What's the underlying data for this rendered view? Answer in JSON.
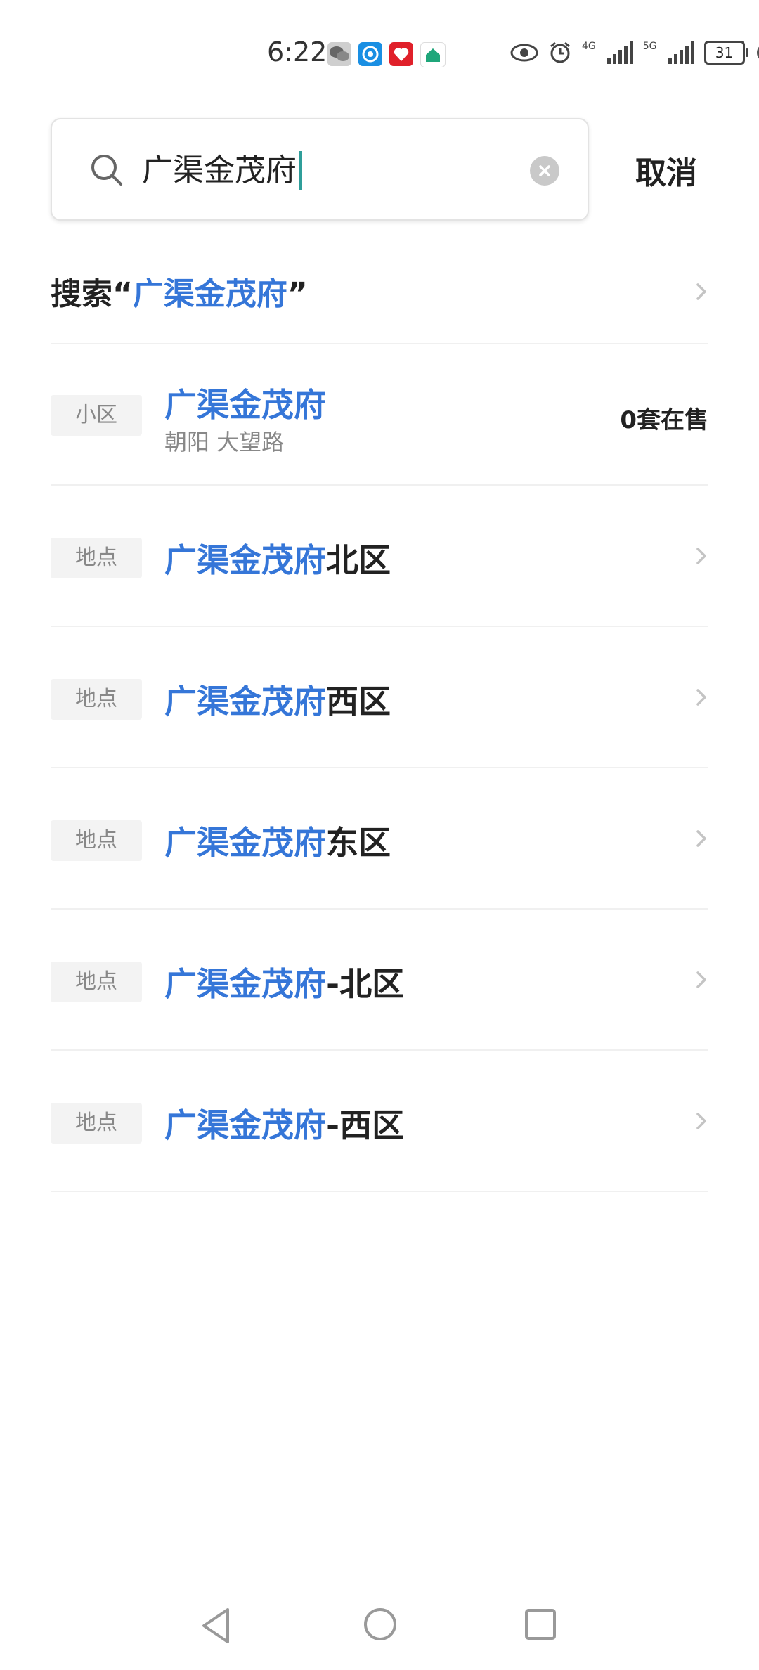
{
  "status_bar": {
    "time": "6:22",
    "net1": "4G",
    "net2": "5G",
    "battery": "31"
  },
  "search": {
    "query": "广渠金茂府",
    "cancel_label": "取消"
  },
  "search_for": {
    "prefix": "搜索“",
    "keyword": "广渠金茂府",
    "suffix": "”"
  },
  "results": [
    {
      "tag": "小区",
      "highlight": "广渠金茂府",
      "rest": "",
      "subtitle": "朝阳 大望路",
      "count": "0套在售"
    },
    {
      "tag": "地点",
      "highlight": "广渠金茂府",
      "rest": "北区"
    },
    {
      "tag": "地点",
      "highlight": "广渠金茂府",
      "rest": "西区"
    },
    {
      "tag": "地点",
      "highlight": "广渠金茂府",
      "rest": "东区"
    },
    {
      "tag": "地点",
      "highlight": "广渠金茂府",
      "rest": "-北区"
    },
    {
      "tag": "地点",
      "highlight": "广渠金茂府",
      "rest": "-西区"
    }
  ],
  "colors": {
    "accent": "#3576d8",
    "cursor": "#2f9e9a"
  }
}
